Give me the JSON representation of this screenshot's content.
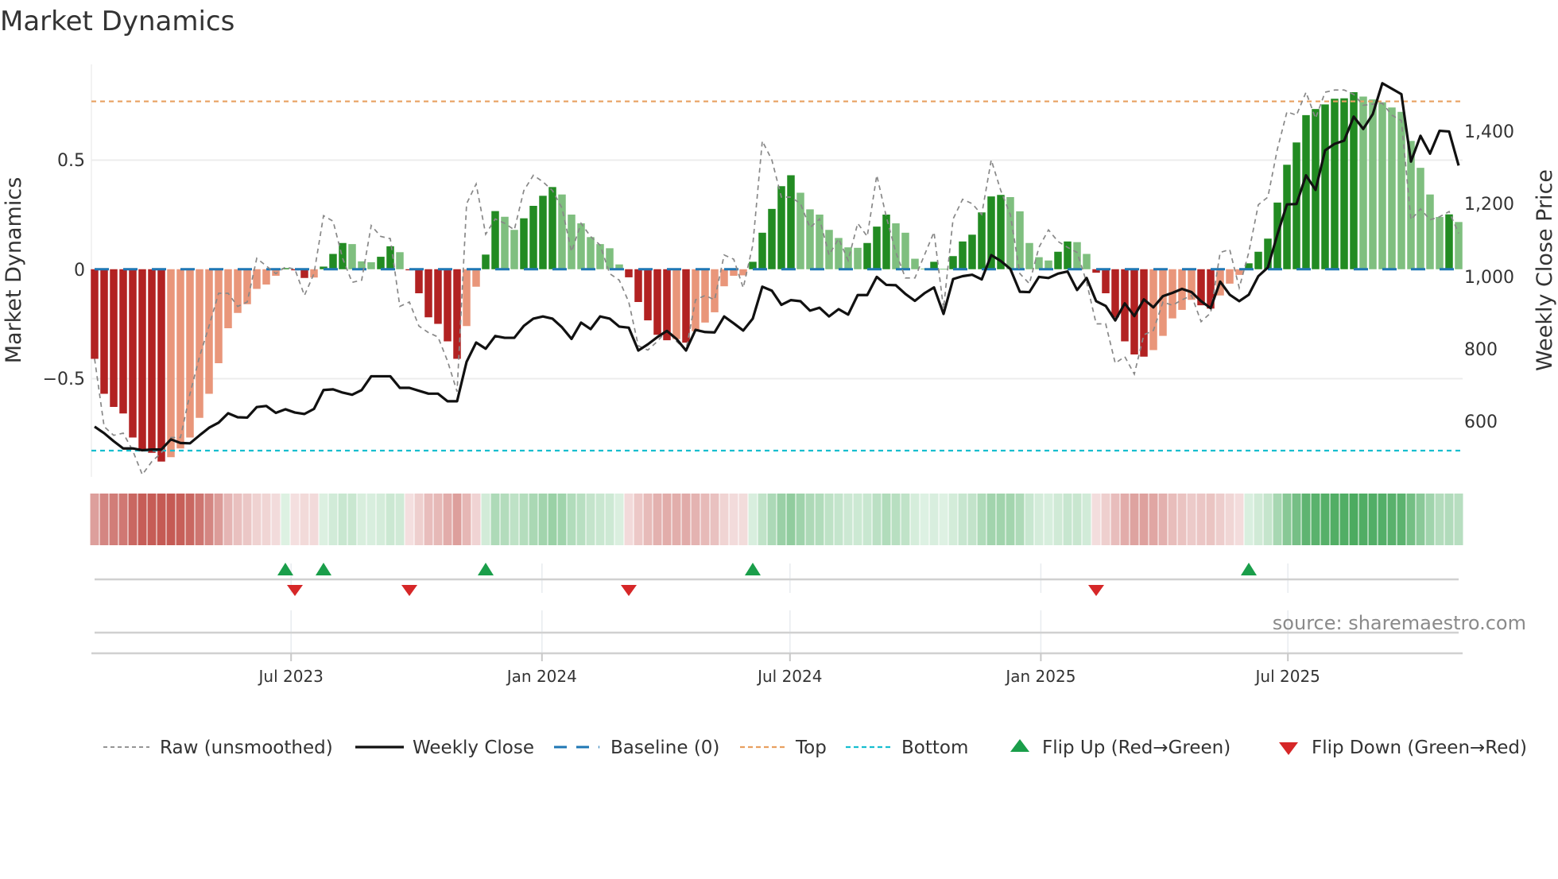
{
  "chart_data": {
    "type": "bar",
    "title": "Market Dynamics",
    "ylabel": "Market Dynamics",
    "ylabel_right": "Weekly Close Price",
    "ylim": [
      -0.95,
      0.92
    ],
    "ylim_right": [
      430,
      1560
    ],
    "x_unit": "week index (weekly bars)",
    "yticks": [
      {
        "value": 0.5,
        "label": "0.5"
      },
      {
        "value": 0,
        "label": "0"
      },
      {
        "value": -0.5,
        "label": "−0.5"
      }
    ],
    "yticks_right": [
      {
        "value": 1400,
        "label": "1,400"
      },
      {
        "value": 1200,
        "label": "1,200"
      },
      {
        "value": 1000,
        "label": "1,000"
      },
      {
        "value": 800,
        "label": "800"
      },
      {
        "value": 600,
        "label": "600"
      }
    ],
    "xticks": [
      {
        "week": 21.6,
        "label": "Jul 2023"
      },
      {
        "week": 47.9,
        "label": "Jan 2024"
      },
      {
        "week": 73.9,
        "label": "Jul 2024"
      },
      {
        "week": 100.2,
        "label": "Jan 2025"
      },
      {
        "week": 126.1,
        "label": "Jul 2025"
      }
    ],
    "levels": {
      "baseline": 0,
      "top": 0.768,
      "bottom": -0.83
    },
    "series": [
      {
        "name": "Market Dynamics (smoothed bars)",
        "values": [
          -0.41,
          -0.57,
          -0.63,
          -0.66,
          -0.77,
          -0.83,
          -0.84,
          -0.88,
          -0.86,
          -0.82,
          -0.77,
          -0.68,
          -0.57,
          -0.43,
          -0.27,
          -0.2,
          -0.16,
          -0.09,
          -0.07,
          -0.03,
          0.005,
          -0.005,
          -0.04,
          -0.038,
          0.012,
          0.07,
          0.12,
          0.115,
          0.036,
          0.032,
          0.057,
          0.105,
          0.078,
          -0.005,
          -0.11,
          -0.22,
          -0.25,
          -0.33,
          -0.41,
          -0.26,
          -0.08,
          0.067,
          0.266,
          0.24,
          0.18,
          0.233,
          0.29,
          0.336,
          0.376,
          0.342,
          0.25,
          0.21,
          0.147,
          0.115,
          0.096,
          0.022,
          -0.037,
          -0.15,
          -0.234,
          -0.3,
          -0.325,
          -0.32,
          -0.336,
          -0.284,
          -0.244,
          -0.197,
          -0.078,
          -0.03,
          -0.028,
          0.034,
          0.167,
          0.276,
          0.38,
          0.43,
          0.35,
          0.274,
          0.25,
          0.18,
          0.143,
          0.1,
          0.098,
          0.12,
          0.195,
          0.25,
          0.21,
          0.167,
          0.048,
          0.003,
          0.034,
          0.002,
          0.06,
          0.127,
          0.158,
          0.26,
          0.333,
          0.34,
          0.33,
          0.265,
          0.12,
          0.055,
          0.04,
          0.08,
          0.127,
          0.124,
          0.07,
          -0.016,
          -0.11,
          -0.22,
          -0.33,
          -0.39,
          -0.4,
          -0.37,
          -0.305,
          -0.225,
          -0.186,
          -0.14,
          -0.165,
          -0.18,
          -0.12,
          -0.066,
          -0.026,
          0.027,
          0.08,
          0.14,
          0.305,
          0.478,
          0.58,
          0.705,
          0.733,
          0.754,
          0.78,
          0.782,
          0.81,
          0.79,
          0.777,
          0.764,
          0.74,
          0.72,
          0.587,
          0.464,
          0.342,
          0.239,
          0.251,
          0.216
        ]
      },
      {
        "name": "Raw (unsmoothed)",
        "values": [
          -0.41,
          -0.72,
          -0.76,
          -0.75,
          -0.83,
          -0.94,
          -0.88,
          -0.84,
          -0.77,
          -0.77,
          -0.57,
          -0.4,
          -0.26,
          -0.11,
          -0.11,
          -0.17,
          -0.15,
          0.05,
          0.015,
          -0.02,
          0.01,
          0.0,
          -0.12,
          -0.02,
          0.245,
          0.22,
          0.05,
          -0.06,
          -0.05,
          0.2,
          0.15,
          0.14,
          -0.17,
          -0.15,
          -0.26,
          -0.29,
          -0.31,
          -0.42,
          -0.56,
          0.3,
          0.39,
          0.16,
          0.23,
          0.21,
          0.18,
          0.36,
          0.43,
          0.4,
          0.36,
          0.28,
          0.08,
          0.21,
          0.15,
          0.11,
          -0.02,
          -0.05,
          -0.15,
          -0.35,
          -0.37,
          -0.33,
          -0.28,
          -0.33,
          -0.37,
          -0.14,
          -0.12,
          -0.14,
          0.065,
          0.046,
          -0.085,
          0.11,
          0.587,
          0.5,
          0.33,
          0.33,
          0.3,
          0.19,
          0.23,
          0.065,
          0.14,
          0.04,
          0.21,
          0.15,
          0.43,
          0.24,
          0.077,
          -0.04,
          -0.04,
          0.065,
          0.17,
          -0.18,
          0.23,
          0.32,
          0.3,
          0.25,
          0.5,
          0.36,
          0.25,
          -0.02,
          -0.066,
          0.1,
          0.18,
          0.127,
          0.1,
          0.077,
          -0.06,
          -0.25,
          -0.25,
          -0.43,
          -0.4,
          -0.48,
          -0.3,
          -0.28,
          -0.15,
          -0.165,
          -0.14,
          -0.12,
          -0.24,
          -0.2,
          0.077,
          0.09,
          -0.085,
          0.077,
          0.295,
          0.33,
          0.55,
          0.72,
          0.705,
          0.81,
          0.69,
          0.81,
          0.82,
          0.82,
          0.8,
          0.75,
          0.755,
          0.76,
          0.705,
          0.68,
          0.226,
          0.276,
          0.226,
          0.24,
          0.264,
          0.164
        ]
      },
      {
        "name": "Weekly Close",
        "axis": "right",
        "values": [
          585,
          567,
          545,
          525,
          525,
          520,
          522,
          522,
          550,
          540,
          539,
          561,
          582,
          596,
          622,
          611,
          610,
          639,
          642,
          623,
          633,
          624,
          620,
          634,
          686,
          688,
          679,
          673,
          686,
          724,
          724,
          724,
          692,
          692,
          684,
          676,
          676,
          655,
          655,
          764,
          817,
          800,
          835,
          830,
          830,
          863,
          883,
          889,
          883,
          859,
          827,
          872,
          854,
          889,
          883,
          861,
          858,
          795,
          812,
          832,
          849,
          827,
          795,
          852,
          846,
          845,
          889,
          870,
          850,
          883,
          971,
          960,
          921,
          934,
          931,
          905,
          913,
          889,
          909,
          894,
          948,
          948,
          998,
          976,
          975,
          951,
          932,
          953,
          969,
          896,
          992,
          1000,
          1004,
          991,
          1058,
          1042,
          1020,
          957,
          956,
          998,
          995,
          1007,
          1013,
          962,
          995,
          931,
          918,
          878,
          925,
          890,
          936,
          914,
          945,
          954,
          965,
          956,
          931,
          912,
          985,
          949,
          931,
          949,
          1000,
          1024,
          1115,
          1198,
          1199,
          1278,
          1238,
          1347,
          1365,
          1374,
          1440,
          1406,
          1447,
          1532,
          1517,
          1502,
          1316,
          1387,
          1338,
          1401,
          1399,
          1305
        ]
      }
    ],
    "flips": {
      "up_weeks": [
        21,
        25,
        42,
        70,
        122
      ],
      "down_weeks": [
        22,
        34,
        57,
        106
      ]
    },
    "colors": {
      "green_dark": "#228b22",
      "green_light": "#7fbf7f",
      "red_dark": "#b22222",
      "red_light": "#e9967a",
      "baseline": "#1f77b4",
      "top": "#e8a060",
      "bottom": "#17becf",
      "close": "#111111",
      "raw": "#888888",
      "flip_up": "#1a9e4a",
      "flip_down": "#d62728"
    },
    "legend": {
      "placement": "bottom",
      "items": [
        {
          "key": "raw",
          "label": "Raw (unsmoothed)"
        },
        {
          "key": "close",
          "label": "Weekly Close"
        },
        {
          "key": "baseline",
          "label": "Baseline (0)"
        },
        {
          "key": "top",
          "label": "Top"
        },
        {
          "key": "bottom",
          "label": "Bottom"
        },
        {
          "key": "flip_up",
          "label": "Flip Up (Red→Green)"
        },
        {
          "key": "flip_down",
          "label": "Flip Down (Green→Red)"
        }
      ]
    },
    "source": "source: sharemaestro.com"
  }
}
